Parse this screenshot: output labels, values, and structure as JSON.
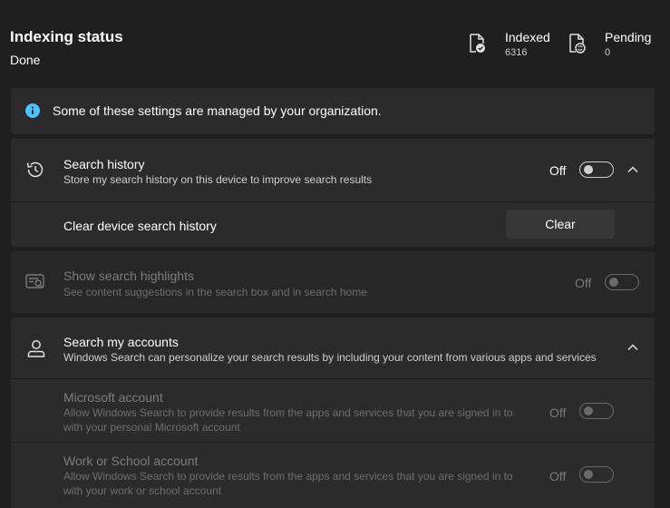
{
  "header": {
    "title": "Indexing status",
    "subtitle": "Done",
    "stats": [
      {
        "label": "Indexed",
        "value": "6316",
        "icon": "document-check-icon"
      },
      {
        "label": "Pending",
        "value": "0",
        "icon": "document-sync-icon"
      }
    ]
  },
  "banner": {
    "text": "Some of these settings are managed by your organization.",
    "icon": "info-icon",
    "accent": "#4cc2ff"
  },
  "search_history": {
    "title": "Search history",
    "description": "Store my search history on this device to improve search results",
    "toggle_state": "Off",
    "clear_row": {
      "label": "Clear device search history",
      "button": "Clear"
    }
  },
  "search_highlights": {
    "title": "Show search highlights",
    "description": "See content suggestions in the search box and in search home",
    "toggle_state": "Off"
  },
  "search_accounts": {
    "title": "Search my accounts",
    "description": "Windows Search can personalize your search results by including your content from various apps and services",
    "items": [
      {
        "title": "Microsoft account",
        "description_line1": "Allow Windows Search to provide results from the apps and services that you are signed in to",
        "description_line2": "with your personal Microsoft account",
        "toggle_state": "Off"
      },
      {
        "title": "Work or School account",
        "description_line1": "Allow Windows Search to provide results from the apps and services that you are signed in to",
        "description_line2": "with your work or school account",
        "toggle_state": "Off"
      }
    ]
  }
}
